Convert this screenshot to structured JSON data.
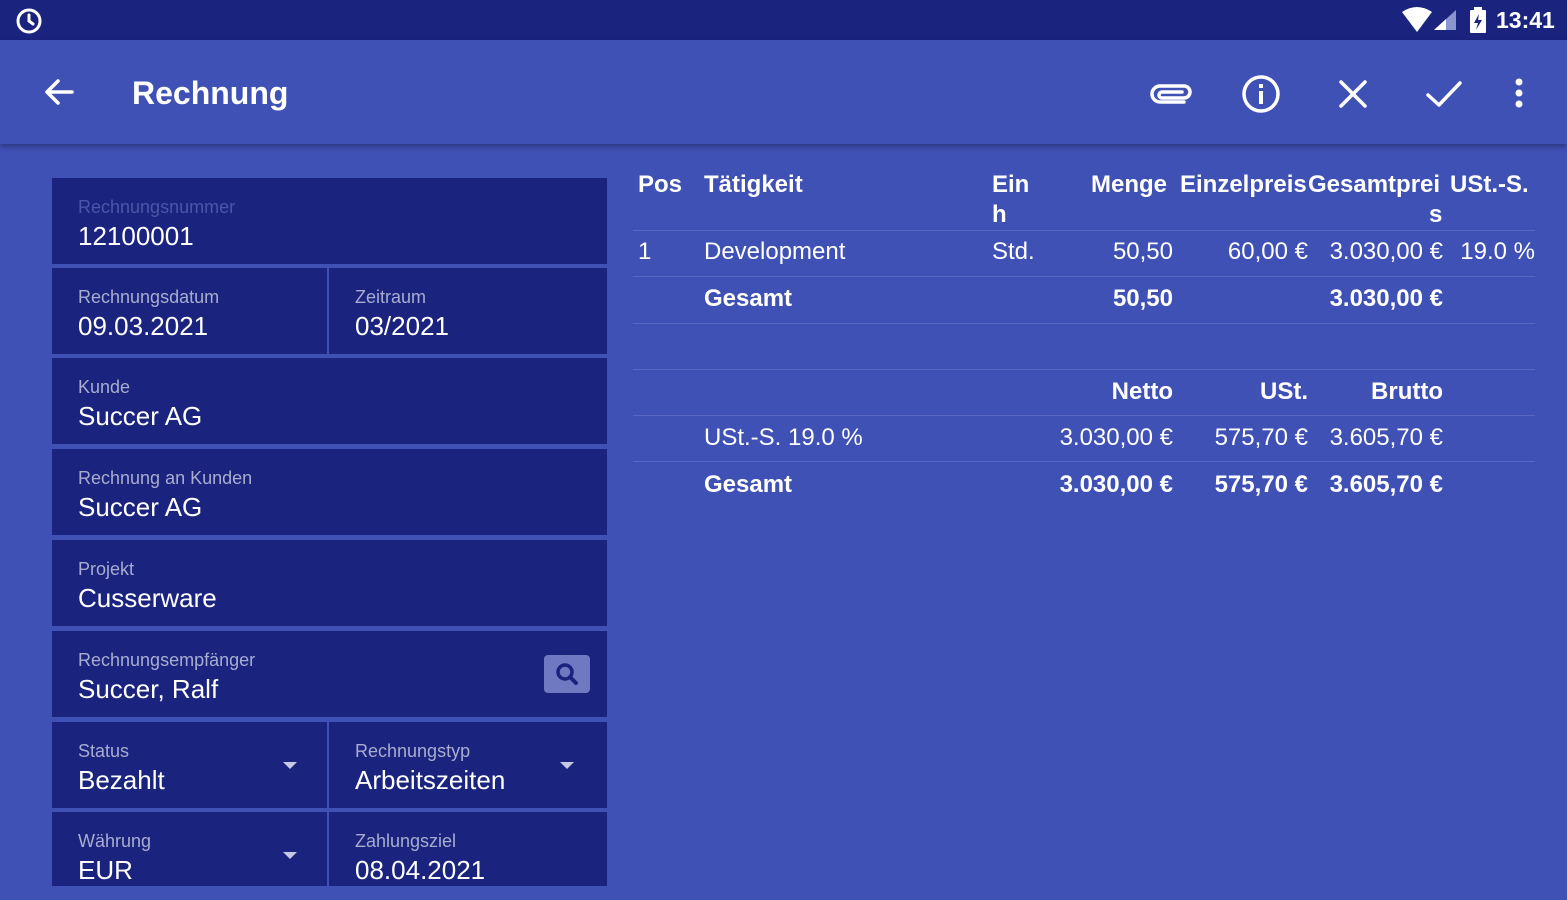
{
  "status_bar": {
    "time": "13:41"
  },
  "app_bar": {
    "title": "Rechnung"
  },
  "form": {
    "invoice_number": {
      "label": "Rechnungsnummer",
      "value": "12100001"
    },
    "invoice_date": {
      "label": "Rechnungsdatum",
      "value": "09.03.2021"
    },
    "period": {
      "label": "Zeitraum",
      "value": "03/2021"
    },
    "customer": {
      "label": "Kunde",
      "value": "Succer AG"
    },
    "bill_to_customer": {
      "label": "Rechnung an Kunden",
      "value": "Succer AG"
    },
    "project": {
      "label": "Projekt",
      "value": "Cusserware"
    },
    "recipient": {
      "label": "Rechnungsempfänger",
      "value": "Succer, Ralf"
    },
    "status": {
      "label": "Status",
      "value": "Bezahlt"
    },
    "invoice_type": {
      "label": "Rechnungstyp",
      "value": "Arbeitszeiten"
    },
    "currency": {
      "label": "Währung",
      "value": "EUR"
    },
    "due_date": {
      "label": "Zahlungsziel",
      "value": "08.04.2021"
    }
  },
  "positions_table": {
    "headers": {
      "pos": "Pos",
      "activity": "Tätigkeit",
      "unit_line1": "Ein",
      "unit_line2": "h",
      "quantity": "Menge",
      "unit_price": "Einzelpreis",
      "total_line1": "Gesamtprei",
      "total_line2": "s",
      "vat_rate": "USt.-S."
    },
    "rows": [
      {
        "pos": "1",
        "activity": "Development",
        "unit": "Std.",
        "quantity": "50,50",
        "unit_price": "60,00 €",
        "total": "3.030,00 €",
        "vat_rate": "19.0 %"
      }
    ],
    "summary": {
      "label": "Gesamt",
      "quantity": "50,50",
      "total": "3.030,00 €"
    }
  },
  "tax_table": {
    "headers": {
      "net": "Netto",
      "vat": "USt.",
      "gross": "Brutto"
    },
    "rows": [
      {
        "label": "USt.-S. 19.0 %",
        "net": "3.030,00 €",
        "vat": "575,70 €",
        "gross": "3.605,70 €"
      }
    ],
    "summary": {
      "label": "Gesamt",
      "net": "3.030,00 €",
      "vat": "575,70 €",
      "gross": "3.605,70 €"
    }
  }
}
